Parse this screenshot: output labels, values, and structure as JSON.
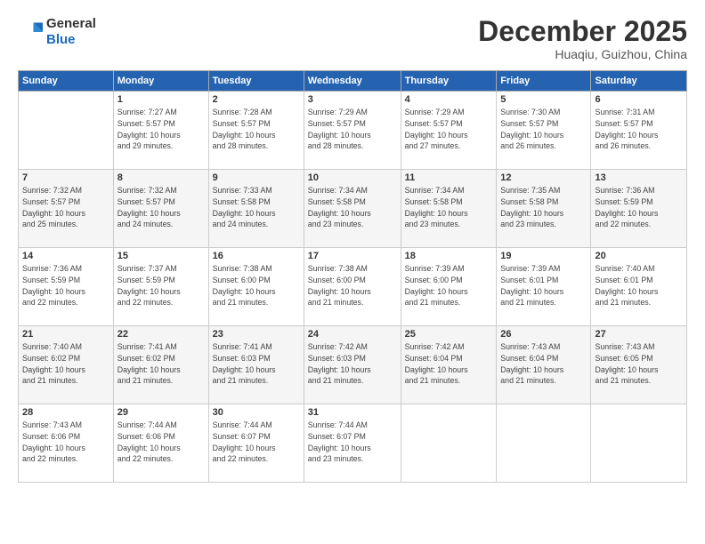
{
  "header": {
    "logo_line1": "General",
    "logo_line2": "Blue",
    "month": "December 2025",
    "location": "Huaqiu, Guizhou, China"
  },
  "days_of_week": [
    "Sunday",
    "Monday",
    "Tuesday",
    "Wednesday",
    "Thursday",
    "Friday",
    "Saturday"
  ],
  "weeks": [
    [
      {
        "day": "",
        "info": ""
      },
      {
        "day": "1",
        "info": "Sunrise: 7:27 AM\nSunset: 5:57 PM\nDaylight: 10 hours\nand 29 minutes."
      },
      {
        "day": "2",
        "info": "Sunrise: 7:28 AM\nSunset: 5:57 PM\nDaylight: 10 hours\nand 28 minutes."
      },
      {
        "day": "3",
        "info": "Sunrise: 7:29 AM\nSunset: 5:57 PM\nDaylight: 10 hours\nand 28 minutes."
      },
      {
        "day": "4",
        "info": "Sunrise: 7:29 AM\nSunset: 5:57 PM\nDaylight: 10 hours\nand 27 minutes."
      },
      {
        "day": "5",
        "info": "Sunrise: 7:30 AM\nSunset: 5:57 PM\nDaylight: 10 hours\nand 26 minutes."
      },
      {
        "day": "6",
        "info": "Sunrise: 7:31 AM\nSunset: 5:57 PM\nDaylight: 10 hours\nand 26 minutes."
      }
    ],
    [
      {
        "day": "7",
        "info": "Sunrise: 7:32 AM\nSunset: 5:57 PM\nDaylight: 10 hours\nand 25 minutes."
      },
      {
        "day": "8",
        "info": "Sunrise: 7:32 AM\nSunset: 5:57 PM\nDaylight: 10 hours\nand 24 minutes."
      },
      {
        "day": "9",
        "info": "Sunrise: 7:33 AM\nSunset: 5:58 PM\nDaylight: 10 hours\nand 24 minutes."
      },
      {
        "day": "10",
        "info": "Sunrise: 7:34 AM\nSunset: 5:58 PM\nDaylight: 10 hours\nand 23 minutes."
      },
      {
        "day": "11",
        "info": "Sunrise: 7:34 AM\nSunset: 5:58 PM\nDaylight: 10 hours\nand 23 minutes."
      },
      {
        "day": "12",
        "info": "Sunrise: 7:35 AM\nSunset: 5:58 PM\nDaylight: 10 hours\nand 23 minutes."
      },
      {
        "day": "13",
        "info": "Sunrise: 7:36 AM\nSunset: 5:59 PM\nDaylight: 10 hours\nand 22 minutes."
      }
    ],
    [
      {
        "day": "14",
        "info": "Sunrise: 7:36 AM\nSunset: 5:59 PM\nDaylight: 10 hours\nand 22 minutes."
      },
      {
        "day": "15",
        "info": "Sunrise: 7:37 AM\nSunset: 5:59 PM\nDaylight: 10 hours\nand 22 minutes."
      },
      {
        "day": "16",
        "info": "Sunrise: 7:38 AM\nSunset: 6:00 PM\nDaylight: 10 hours\nand 21 minutes."
      },
      {
        "day": "17",
        "info": "Sunrise: 7:38 AM\nSunset: 6:00 PM\nDaylight: 10 hours\nand 21 minutes."
      },
      {
        "day": "18",
        "info": "Sunrise: 7:39 AM\nSunset: 6:00 PM\nDaylight: 10 hours\nand 21 minutes."
      },
      {
        "day": "19",
        "info": "Sunrise: 7:39 AM\nSunset: 6:01 PM\nDaylight: 10 hours\nand 21 minutes."
      },
      {
        "day": "20",
        "info": "Sunrise: 7:40 AM\nSunset: 6:01 PM\nDaylight: 10 hours\nand 21 minutes."
      }
    ],
    [
      {
        "day": "21",
        "info": "Sunrise: 7:40 AM\nSunset: 6:02 PM\nDaylight: 10 hours\nand 21 minutes."
      },
      {
        "day": "22",
        "info": "Sunrise: 7:41 AM\nSunset: 6:02 PM\nDaylight: 10 hours\nand 21 minutes."
      },
      {
        "day": "23",
        "info": "Sunrise: 7:41 AM\nSunset: 6:03 PM\nDaylight: 10 hours\nand 21 minutes."
      },
      {
        "day": "24",
        "info": "Sunrise: 7:42 AM\nSunset: 6:03 PM\nDaylight: 10 hours\nand 21 minutes."
      },
      {
        "day": "25",
        "info": "Sunrise: 7:42 AM\nSunset: 6:04 PM\nDaylight: 10 hours\nand 21 minutes."
      },
      {
        "day": "26",
        "info": "Sunrise: 7:43 AM\nSunset: 6:04 PM\nDaylight: 10 hours\nand 21 minutes."
      },
      {
        "day": "27",
        "info": "Sunrise: 7:43 AM\nSunset: 6:05 PM\nDaylight: 10 hours\nand 21 minutes."
      }
    ],
    [
      {
        "day": "28",
        "info": "Sunrise: 7:43 AM\nSunset: 6:06 PM\nDaylight: 10 hours\nand 22 minutes."
      },
      {
        "day": "29",
        "info": "Sunrise: 7:44 AM\nSunset: 6:06 PM\nDaylight: 10 hours\nand 22 minutes."
      },
      {
        "day": "30",
        "info": "Sunrise: 7:44 AM\nSunset: 6:07 PM\nDaylight: 10 hours\nand 22 minutes."
      },
      {
        "day": "31",
        "info": "Sunrise: 7:44 AM\nSunset: 6:07 PM\nDaylight: 10 hours\nand 23 minutes."
      },
      {
        "day": "",
        "info": ""
      },
      {
        "day": "",
        "info": ""
      },
      {
        "day": "",
        "info": ""
      }
    ]
  ]
}
